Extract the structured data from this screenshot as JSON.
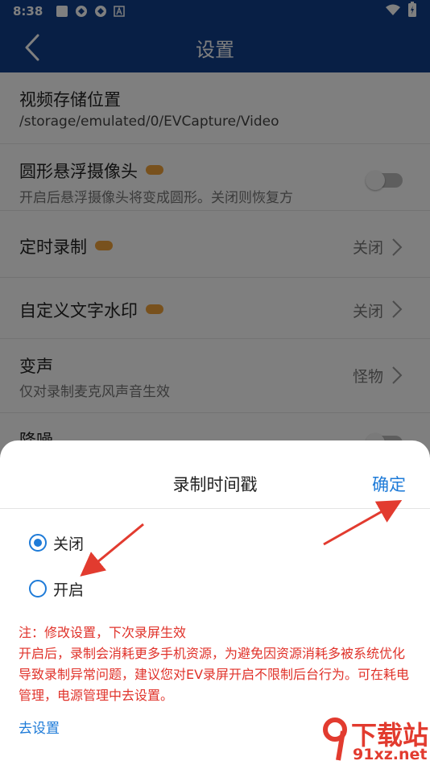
{
  "status_bar": {
    "time": "8:38"
  },
  "app_bar": {
    "title": "设置"
  },
  "settings": {
    "storage": {
      "title": "视频存储位置",
      "path": "/storage/emulated/0/EVCapture/Video"
    },
    "round_camera": {
      "title": "圆形悬浮摄像头",
      "subtitle": "开启后悬浮摄像头将变成圆形。关闭则恢复方",
      "enabled": false
    },
    "timed_record": {
      "title": "定时录制",
      "value": "关闭"
    },
    "text_watermark": {
      "title": "自定义文字水印",
      "value": "关闭"
    },
    "voice_change": {
      "title": "变声",
      "subtitle": "仅对录制麦克风声音生效",
      "value": "怪物"
    },
    "noise_reduction": {
      "title": "降噪",
      "enabled": false
    }
  },
  "dialog": {
    "title": "录制时间戳",
    "confirm": "确定",
    "options": [
      {
        "label": "关闭",
        "selected": true
      },
      {
        "label": "开启",
        "selected": false
      }
    ],
    "note_lines": [
      "注：修改设置，下次录屏生效",
      "开启后，录制会消耗更多手机资源，为避免因资源消耗多被系统优化导致录制异常问题，建议您对EV录屏开启不限制后台行为。可在耗电管理，电源管理中去设置。"
    ],
    "goto_settings": "去设置"
  },
  "watermark": {
    "line1": "下载站",
    "line2": "91xz.net"
  },
  "colors": {
    "primary": "#103e8a",
    "accent": "#1e7bd8",
    "warning": "#e0322a",
    "annotation_arrow": "#e23b2f"
  }
}
